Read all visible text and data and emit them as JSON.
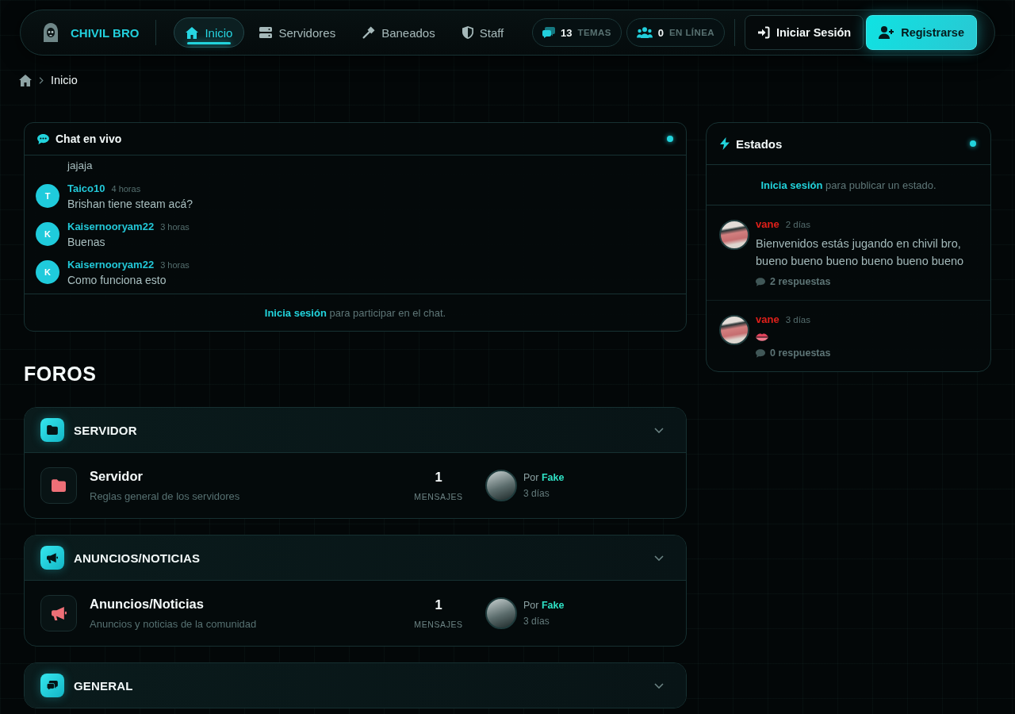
{
  "header": {
    "brand": "CHIVIL BRO",
    "nav": [
      {
        "kind": "home",
        "label": "Inicio",
        "selected": true
      },
      {
        "kind": "servers",
        "label": "Servidores",
        "selected": false
      },
      {
        "kind": "bans",
        "label": "Baneados",
        "selected": false
      },
      {
        "kind": "staff",
        "label": "Staff",
        "selected": false
      }
    ],
    "stats": [
      {
        "kind": "topics",
        "value": "13",
        "label": "TEMAS"
      },
      {
        "kind": "online",
        "value": "0",
        "label": "EN LÍNEA"
      }
    ],
    "buttons": [
      {
        "kind": "login",
        "label": "Iniciar Sesión"
      },
      {
        "kind": "register",
        "label": "Registrarse"
      }
    ]
  },
  "breadcrumb": {
    "current": "Inicio"
  },
  "chat": {
    "title": "Chat en vivo",
    "messages": [
      {
        "kind": "tail",
        "text": "jajaja"
      },
      {
        "kind": "message",
        "initial": "T",
        "author": "Taico10",
        "time": "4 horas",
        "text": "Brishan tiene steam acá?"
      },
      {
        "kind": "message",
        "initial": "K",
        "author": "Kaisernooryam22",
        "time": "3 horas",
        "text": "Buenas"
      },
      {
        "kind": "message",
        "initial": "K",
        "author": "Kaisernooryam22",
        "time": "3 horas",
        "text": "Como funciona esto"
      }
    ],
    "login_prompt": {
      "link": "Inicia sesión",
      "text": "para participar en el chat."
    }
  },
  "statuses": {
    "title": "Estados",
    "login_prompt": {
      "link": "Inicia sesión",
      "text": "para publicar un estado."
    },
    "items": [
      {
        "kind": "text",
        "author": "vane",
        "color": "#e0201a",
        "time": "2 días",
        "text": "Bienvenidos estás jugando en chivil bro, bueno bueno bueno bueno bueno bueno",
        "replies": "2 respuestas"
      },
      {
        "kind": "emoji",
        "author": "vane",
        "color": "#e0201a",
        "time": "3 días",
        "replies": "0 respuestas"
      }
    ]
  },
  "forums": {
    "title": "FOROS",
    "categories": [
      {
        "kind": "rules",
        "title": "SERVIDOR",
        "forums": [
          {
            "kind": "rules",
            "title": "Servidor",
            "description": "Reglas general de los servidores",
            "count": "1",
            "count_label": "MENSAJES",
            "last_post": {
              "by": "Por",
              "author": "Fake",
              "time": "3 días"
            }
          }
        ]
      },
      {
        "kind": "news",
        "title": "ANUNCIOS/NOTICIAS",
        "forums": [
          {
            "kind": "news",
            "title": "Anuncios/Noticias",
            "description": "Anuncios y noticias de la comunidad",
            "count": "1",
            "count_label": "MENSAJES",
            "last_post": {
              "by": "Por",
              "author": "Fake",
              "time": "3 días"
            }
          }
        ]
      },
      {
        "kind": "general",
        "title": "GENERAL"
      }
    ]
  }
}
